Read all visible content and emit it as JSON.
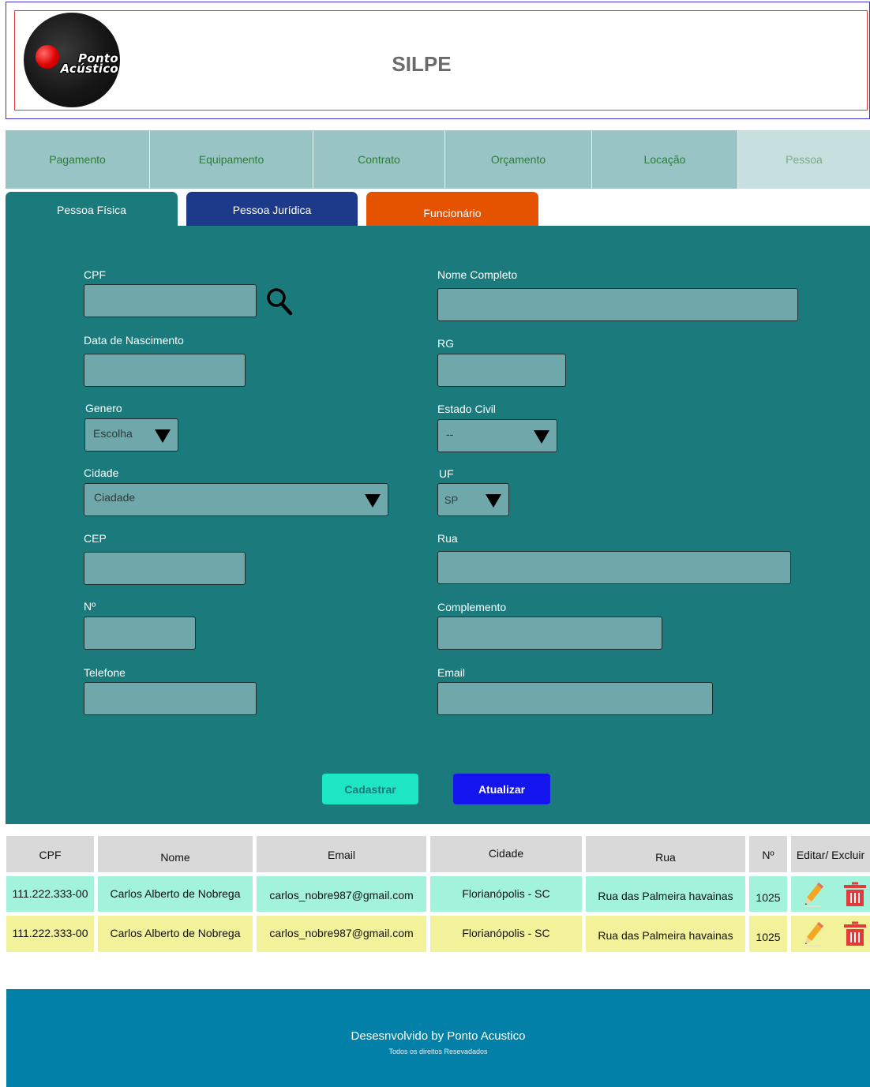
{
  "header": {
    "logo_text_line1": "Ponto",
    "logo_text_line2": "Acústico",
    "title": "SILPE"
  },
  "nav": {
    "items": [
      "Pagamento",
      "Equipamento",
      "Contrato",
      "Orçamento",
      "Locação",
      "Pessoa"
    ],
    "active": "Pessoa"
  },
  "tabs": {
    "pessoa_fisica": "Pessoa Física",
    "pessoa_juridica": "Pessoa Jurídica",
    "funcionario": "Funcionário"
  },
  "form": {
    "cpf_label": "CPF",
    "nome_label": "Nome Completo",
    "nascimento_label": "Data de Nascimento",
    "rg_label": "RG",
    "genero_label": "Genero",
    "genero_value": "Escolha",
    "estado_civil_label": "Estado Civil",
    "estado_civil_value": "--",
    "cidade_label": "Cidade",
    "cidade_value": "Ciadade",
    "uf_label": "UF",
    "uf_value": "SP",
    "cep_label": "CEP",
    "rua_label": "Rua",
    "numero_label": "Nº",
    "complemento_label": "Complemento",
    "telefone_label": "Telefone",
    "email_label": "Email",
    "cadastrar": "Cadastrar",
    "atualizar": "Atualizar"
  },
  "table": {
    "headers": [
      "CPF",
      "Nome",
      "Email",
      "Cidade",
      "Rua",
      "Nº",
      "Editar/ Excluir"
    ],
    "rows": [
      [
        "111.222.333-00",
        "Carlos Alberto de Nobrega",
        "carlos_nobre987@gmail.com",
        "Florianópolis - SC",
        "Rua das Palmeira havainas",
        "1025"
      ],
      [
        "111.222.333-00",
        "Carlos Alberto de Nobrega",
        "carlos_nobre987@gmail.com",
        "Florianópolis - SC",
        "Rua das Palmeira havainas",
        "1025"
      ]
    ]
  },
  "footer": {
    "main": "Desesnvolvido by Ponto Acustico",
    "sub": "Todos os direitos Resevadados"
  },
  "colors": {
    "panel": "#1a7a7c",
    "nav": "#99c4c6",
    "tab_juridica": "#1d3a8a",
    "tab_funcionario": "#e55300",
    "btn_cadastrar": "#1de6c2",
    "btn_atualizar": "#1414ee",
    "row_green": "#a3f2dc",
    "row_yellow": "#f2f29a",
    "footer": "#0380a8"
  },
  "icons": {
    "search": "search-icon",
    "edit": "pencil-icon",
    "delete": "trash-icon",
    "dropdown": "triangle-down-icon"
  }
}
